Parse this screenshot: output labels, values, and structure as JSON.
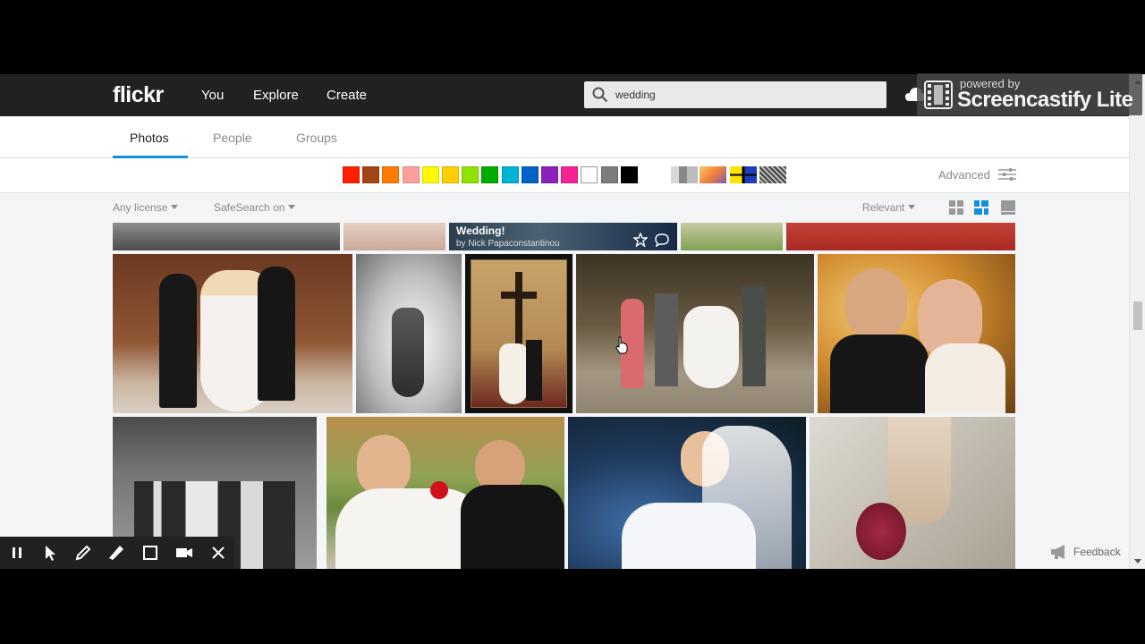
{
  "nav": {
    "logo": "flickr",
    "links": [
      "You",
      "Explore",
      "Create"
    ],
    "search_value": "wedding"
  },
  "overlay": {
    "powered_by": "powered by",
    "name": "Screencastify Lite"
  },
  "tabs": [
    "Photos",
    "People",
    "Groups"
  ],
  "active_tab": "Photos",
  "colors": [
    "#ff2000",
    "#a24615",
    "#ff7c00",
    "#ff9f9c",
    "#fffa00",
    "#ffcf00",
    "#90e200",
    "#00ab00",
    "#00b2d4",
    "#0062c6",
    "#8c20ba",
    "#f52394",
    "#ffffff",
    "#7c7c7c",
    "#000000"
  ],
  "advanced_label": "Advanced",
  "filters": {
    "license": "Any license",
    "safesearch": "SafeSearch on",
    "sort": "Relevant"
  },
  "photos": {
    "hover_title": "Wedding!",
    "hover_author": "by Nick Papaconstantinou"
  },
  "feedback_label": "Feedback",
  "theme": {
    "nav_bg": "#212124",
    "accent": "#128fdc"
  }
}
